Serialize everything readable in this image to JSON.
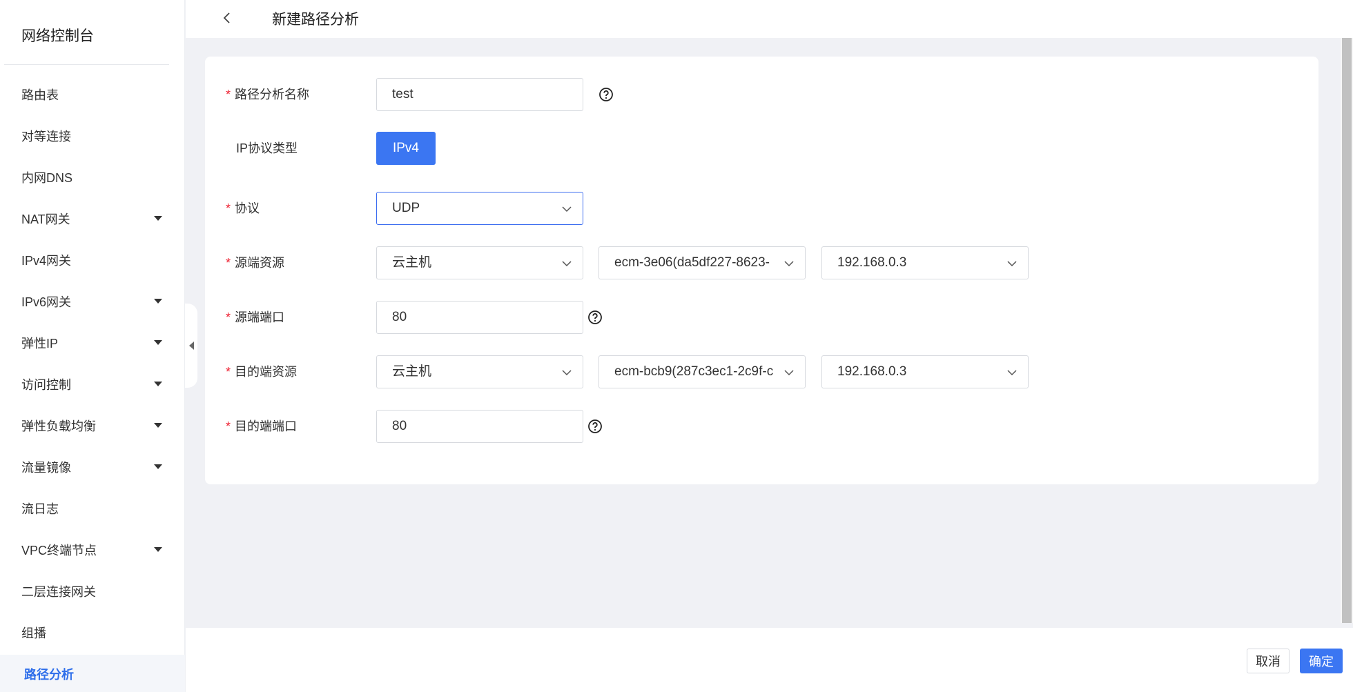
{
  "sidebar": {
    "title": "网络控制台",
    "items": [
      {
        "label": "路由表",
        "has_submenu": false
      },
      {
        "label": "对等连接",
        "has_submenu": false
      },
      {
        "label": "内网DNS",
        "has_submenu": false
      },
      {
        "label": "NAT网关",
        "has_submenu": true
      },
      {
        "label": "IPv4网关",
        "has_submenu": false
      },
      {
        "label": "IPv6网关",
        "has_submenu": true
      },
      {
        "label": "弹性IP",
        "has_submenu": true
      },
      {
        "label": "访问控制",
        "has_submenu": true
      },
      {
        "label": "弹性负载均衡",
        "has_submenu": true
      },
      {
        "label": "流量镜像",
        "has_submenu": true
      },
      {
        "label": "流日志",
        "has_submenu": false
      },
      {
        "label": "VPC终端节点",
        "has_submenu": true
      },
      {
        "label": "二层连接网关",
        "has_submenu": false
      },
      {
        "label": "组播",
        "has_submenu": false
      },
      {
        "label": "路径分析",
        "has_submenu": false,
        "active": true
      }
    ]
  },
  "header": {
    "title": "新建路径分析"
  },
  "form": {
    "name": {
      "label": "路径分析名称",
      "value": "test"
    },
    "ip_type": {
      "label": "IP协议类型",
      "option": "IPv4"
    },
    "protocol": {
      "label": "协议",
      "value": "UDP"
    },
    "source": {
      "label": "源端资源",
      "type": "云主机",
      "instance": "ecm-3e06(da5df227-8623-",
      "ip": "192.168.0.3"
    },
    "source_port": {
      "label": "源端端口",
      "value": "80"
    },
    "dest": {
      "label": "目的端资源",
      "type": "云主机",
      "instance": "ecm-bcb9(287c3ec1-2c9f-c",
      "ip": "192.168.0.3"
    },
    "dest_port": {
      "label": "目的端端口",
      "value": "80"
    },
    "required_mark": "*"
  },
  "footer": {
    "cancel": "取消",
    "confirm": "确定"
  },
  "colors": {
    "primary": "#3b76f2",
    "required": "#e23",
    "active_nav": "#2f6fea"
  }
}
